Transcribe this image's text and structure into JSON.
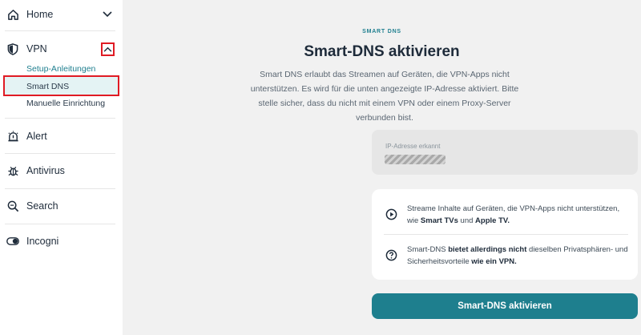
{
  "sidebar": {
    "home": {
      "label": "Home",
      "icon": "home-icon"
    },
    "vpn": {
      "label": "VPN",
      "icon": "shield-icon",
      "sub": {
        "setup": "Setup-Anleitungen",
        "smart_dns": "Smart DNS",
        "manual": "Manuelle Einrichtung"
      }
    },
    "alert": {
      "label": "Alert",
      "icon": "alert-icon"
    },
    "antivirus": {
      "label": "Antivirus",
      "icon": "bug-icon"
    },
    "search": {
      "label": "Search",
      "icon": "search-icon"
    },
    "incogni": {
      "label": "Incogni",
      "icon": "toggle-icon"
    }
  },
  "main": {
    "eyebrow": "SMART DNS",
    "title": "Smart-DNS aktivieren",
    "description": "Smart DNS erlaubt das Streamen auf Geräten, die VPN-Apps nicht unterstützen. Es wird für die unten angezeigte IP-Adresse aktiviert. Bitte stelle sicher, dass du nicht mit einem VPN oder einem Proxy-Server verbunden bist.",
    "ip_label": "IP-Adresse erkannt",
    "info1": {
      "pre": "Streame Inhalte auf Geräten, die VPN-Apps nicht unterstützen, wie ",
      "b1": "Smart TVs",
      "mid": " und ",
      "b2": "Apple TV."
    },
    "info2": {
      "pre": "Smart-DNS ",
      "b1": "bietet allerdings nicht",
      "mid": " dieselben Privatsphären- und Sicherheitsvorteile ",
      "b2": "wie ein VPN."
    },
    "button_label": "Smart-DNS aktivieren"
  },
  "colors": {
    "accent": "#1e7f8e",
    "highlight": "#e01b24",
    "selected_bg": "#e4f3f4"
  }
}
